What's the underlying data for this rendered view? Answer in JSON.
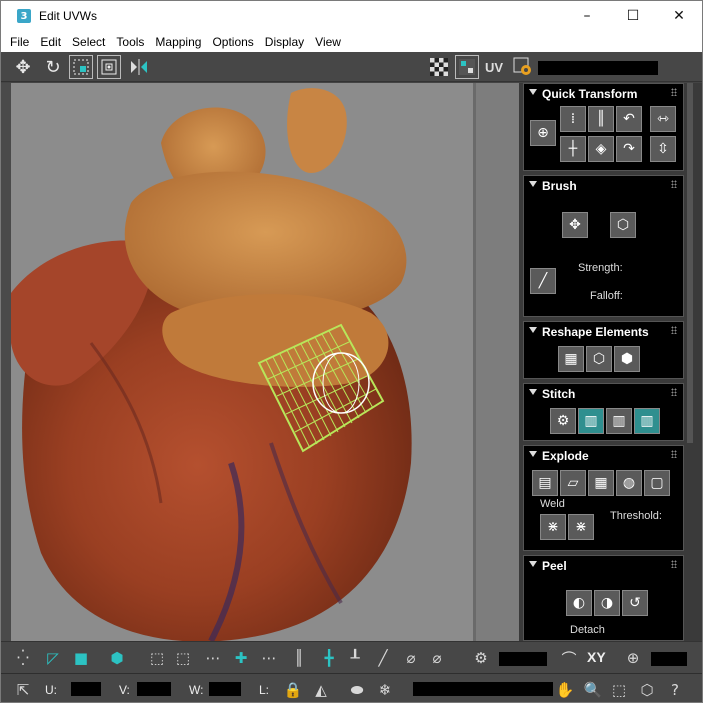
{
  "window": {
    "title": "Edit UVWs",
    "app_icon_char": "3",
    "minimize": "–",
    "maximize": "☐",
    "close": "✕"
  },
  "menu": [
    "File",
    "Edit",
    "Select",
    "Tools",
    "Mapping",
    "Options",
    "Display",
    "View"
  ],
  "top_toolbar": {
    "uv_label": "UV"
  },
  "panels": {
    "quick_transform": {
      "title": "Quick Transform"
    },
    "brush": {
      "title": "Brush",
      "strength_label": "Strength:",
      "falloff_label": "Falloff:"
    },
    "reshape": {
      "title": "Reshape Elements"
    },
    "stitch": {
      "title": "Stitch"
    },
    "explode": {
      "title": "Explode",
      "weld_label": "Weld",
      "threshold_label": "Threshold:"
    },
    "peel": {
      "title": "Peel",
      "detach_label": "Detach"
    }
  },
  "bottom_toolbar": {
    "xy_label": "XY",
    "u_label": "U:",
    "v_label": "V:",
    "w_label": "W:",
    "l_label": "L:"
  },
  "colors": {
    "accent_teal": "#2cc3c3",
    "uv_wire": "#b8e65a",
    "toolbar_bg": "#474747",
    "panel_bg": "#000000"
  }
}
